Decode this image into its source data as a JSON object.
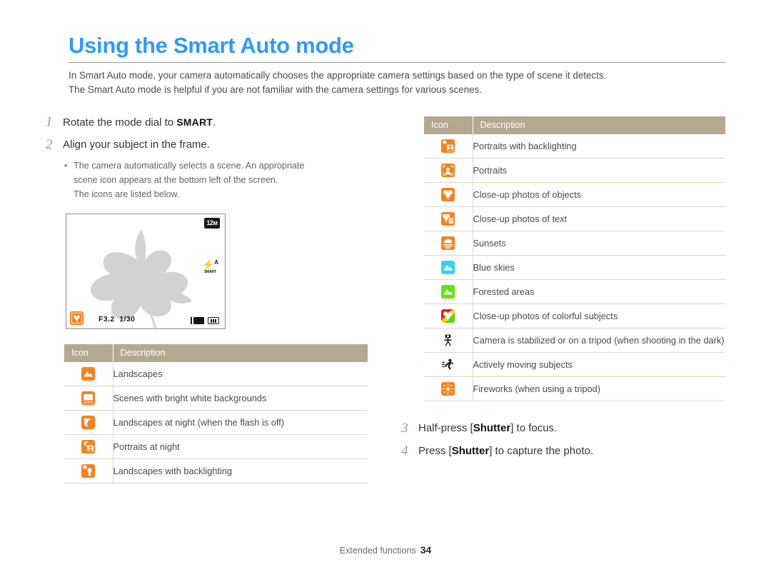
{
  "title": "Using the Smart Auto mode",
  "intro": {
    "line1": "In Smart Auto mode, your camera automatically chooses the appropriate camera settings based on the type of scene it detects.",
    "line2": "The Smart Auto mode is helpful if you are not familiar with the camera settings for various scenes."
  },
  "steps": {
    "step1": {
      "num": "1",
      "text_before": "Rotate the mode dial to ",
      "dial_label": "SMART",
      "text_after": "."
    },
    "step2": {
      "num": "2",
      "text": "Align your subject in the frame."
    },
    "step3": {
      "num": "3",
      "text_before": "Half-press [",
      "key": "Shutter",
      "text_after": "] to focus."
    },
    "step4": {
      "num": "4",
      "text_before": "Press [",
      "key": "Shutter",
      "text_after": "] to capture the photo."
    }
  },
  "bullets": [
    "The camera automatically selects a scene. An appropriate",
    "scene icon appears at the bottom left of the screen.",
    "The icons are listed below."
  ],
  "camera_screen": {
    "resolution_badge": "12м",
    "flash_mode_label": "SMART",
    "aperture": "F3.2",
    "shutter_speed": "1/30",
    "macro_icon": "macro-flower-icon",
    "card_icon": "memory-card-icon",
    "battery_icon": "battery-full-icon"
  },
  "table_left": {
    "headers": {
      "icon": "Icon",
      "description": "Description"
    },
    "rows": [
      {
        "icon": "landscape-icon",
        "description": "Landscapes"
      },
      {
        "icon": "white-background-icon",
        "description": "Scenes with bright white backgrounds"
      },
      {
        "icon": "night-landscape-icon",
        "description": "Landscapes at night (when the flash is off)"
      },
      {
        "icon": "night-portrait-icon",
        "description": "Portraits at night"
      },
      {
        "icon": "backlight-landscape-icon",
        "description": "Landscapes with backlighting"
      }
    ]
  },
  "table_right": {
    "headers": {
      "icon": "Icon",
      "description": "Description"
    },
    "rows": [
      {
        "icon": "backlight-portrait-icon",
        "description": "Portraits with backlighting"
      },
      {
        "icon": "portrait-icon",
        "description": "Portraits"
      },
      {
        "icon": "macro-icon",
        "description": "Close-up photos of objects"
      },
      {
        "icon": "macro-text-icon",
        "description": "Close-up photos of text"
      },
      {
        "icon": "sunset-icon",
        "description": "Sunsets"
      },
      {
        "icon": "blue-sky-icon",
        "description": "Blue skies"
      },
      {
        "icon": "forest-icon",
        "description": "Forested areas"
      },
      {
        "icon": "macro-color-icon",
        "description": "Close-up photos of colorful subjects"
      },
      {
        "icon": "tripod-icon",
        "description": "Camera is stabilized or on a tripod (when shooting in the dark)"
      },
      {
        "icon": "action-icon",
        "description": "Actively moving subjects"
      },
      {
        "icon": "fireworks-icon",
        "description": "Fireworks (when using a tripod)"
      }
    ]
  },
  "footer": {
    "section": "Extended functions",
    "page": "34"
  },
  "colors": {
    "title_blue": "#3399f5",
    "table_header": "#b4a890",
    "icon_orange": "#f58220",
    "step_number": "#a59684"
  }
}
